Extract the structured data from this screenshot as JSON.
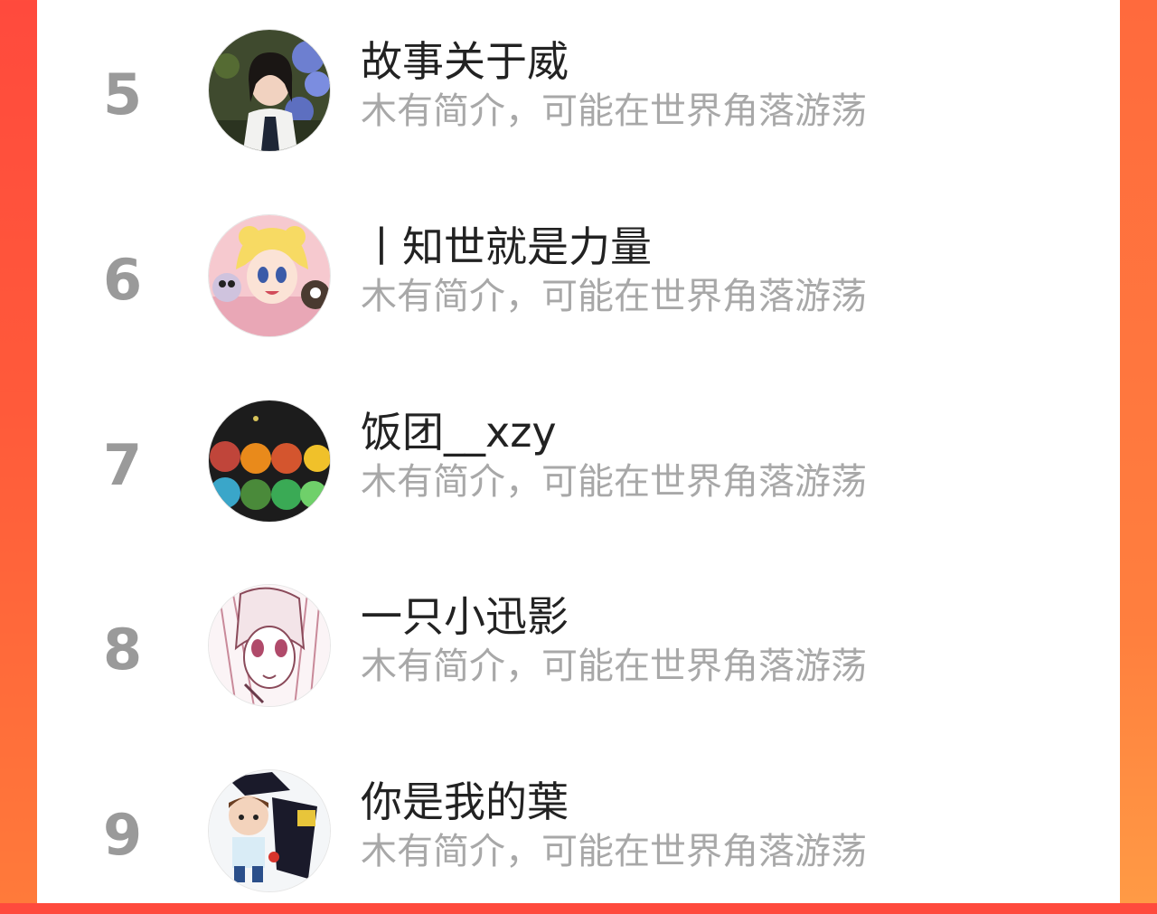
{
  "list": {
    "items": [
      {
        "rank": "5",
        "name": "故事关于威",
        "bio": "木有简介，可能在世界角落游荡",
        "avatar": "avatar-photo-woman-flowers"
      },
      {
        "rank": "6",
        "name": "丨知世就是力量",
        "bio": "木有简介，可能在世界角落游荡",
        "avatar": "avatar-anime-sailor-moon"
      },
      {
        "rank": "7",
        "name": "饭团__xzy",
        "bio": "木有简介，可能在世界角落游荡",
        "avatar": "avatar-game-bubbles"
      },
      {
        "rank": "8",
        "name": "一只小迅影",
        "bio": "木有简介，可能在世界角落游荡",
        "avatar": "avatar-manga-girl"
      },
      {
        "rank": "9",
        "name": "你是我的葉",
        "bio": "木有简介，可能在世界角落游荡",
        "avatar": "avatar-graduation-doll"
      }
    ]
  },
  "colors": {
    "background_gradient_top": "#ff4a3d",
    "background_gradient_bottom": "#ff7a3a",
    "panel": "#ffffff",
    "rank_text": "#9a9a9a",
    "name_text": "#222222",
    "bio_text": "#a8a8a8"
  }
}
